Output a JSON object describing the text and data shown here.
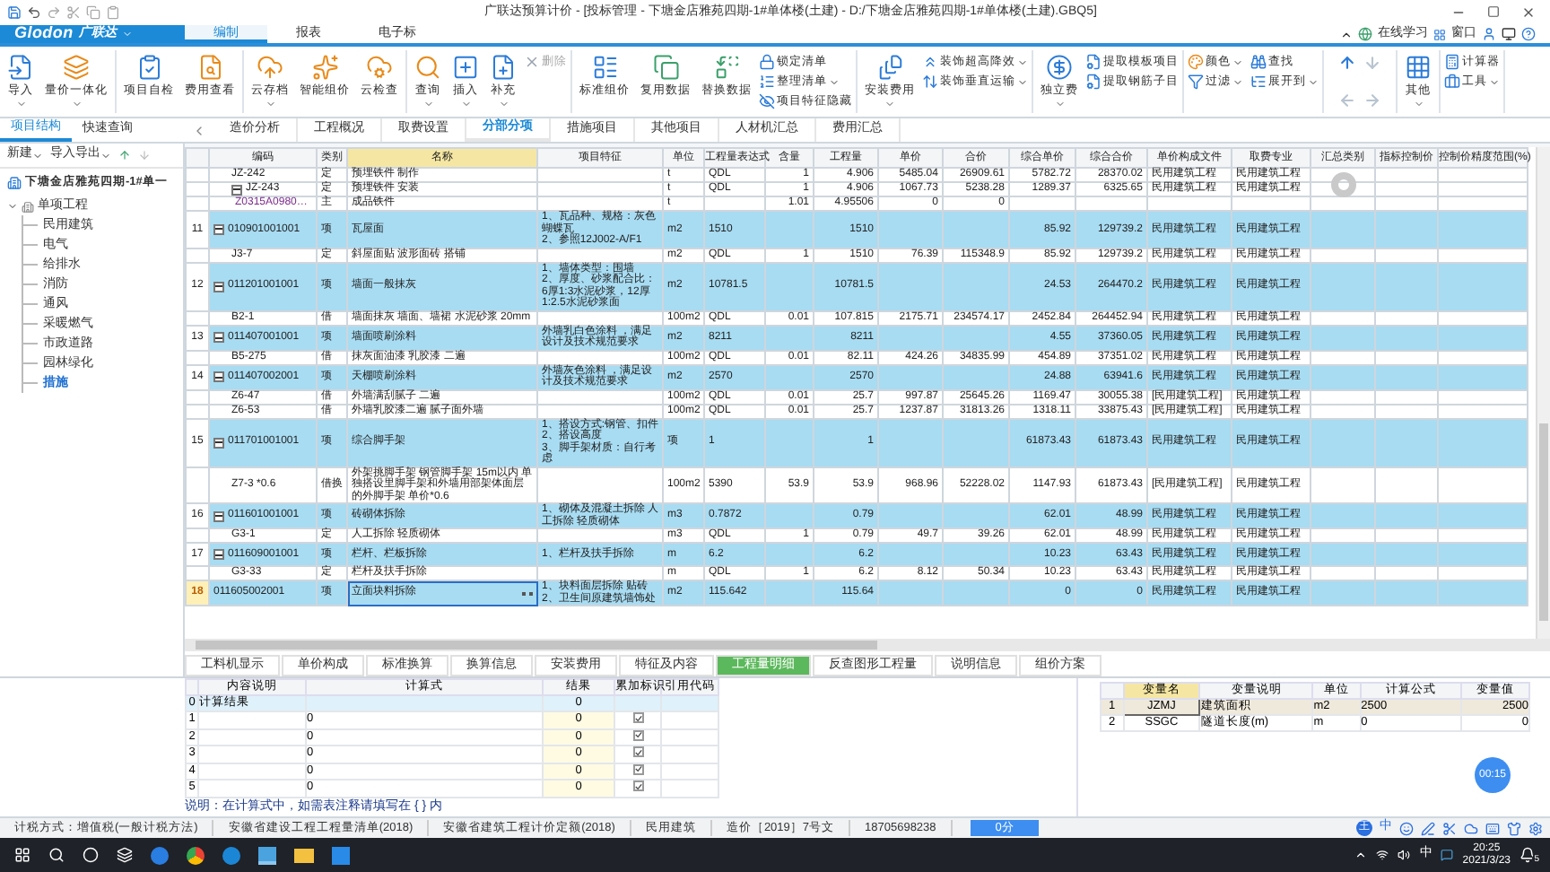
{
  "window": {
    "title": "广联达预算计价 - [投标管理 - 下塘金店雅苑四期-1#单体楼(土建) - D:/下塘金店雅苑四期-1#单体楼(土建).GBQ5]"
  },
  "app_menu": {
    "logo_latin": "Glodon",
    "logo_cn": "广联达",
    "tabs": [
      {
        "label": "编制",
        "selected": true
      },
      {
        "label": "报表",
        "selected": false
      },
      {
        "label": "电子标",
        "selected": false
      }
    ],
    "learn": "在线学习",
    "window_menu": "窗口"
  },
  "ribbon": [
    {
      "kind": "buttons",
      "items": [
        {
          "label": "导入",
          "kind": "large",
          "dropdown": true
        },
        {
          "label": "量价一体化",
          "kind": "large",
          "dropdown": true
        }
      ]
    },
    {
      "kind": "buttons",
      "items": [
        {
          "label": "项目自检",
          "kind": "large",
          "dropdown": false
        },
        {
          "label": "费用查看",
          "kind": "large",
          "dropdown": false
        }
      ]
    },
    {
      "kind": "buttons",
      "items": [
        {
          "label": "云存档",
          "kind": "large",
          "dropdown": true
        },
        {
          "label": "智能组价",
          "kind": "large",
          "dropdown": false
        },
        {
          "label": "云检查",
          "kind": "large",
          "dropdown": false
        }
      ]
    },
    {
      "kind": "buttons",
      "items": [
        {
          "label": "查询",
          "kind": "large",
          "dropdown": true
        },
        {
          "label": "插入",
          "kind": "large",
          "dropdown": true
        },
        {
          "label": "补充",
          "kind": "large",
          "dropdown": true
        },
        {
          "label": "删除",
          "kind": "small",
          "dropdown": false,
          "disabled": true
        }
      ]
    },
    {
      "kind": "buttons",
      "items": [
        {
          "label": "标准组价",
          "kind": "large",
          "dropdown": false
        },
        {
          "label": "复用数据",
          "kind": "large",
          "dropdown": false
        },
        {
          "label": "替换数据",
          "kind": "large",
          "dropdown": false
        },
        {
          "label": "锁定清单",
          "kind": "small",
          "dropdown": false
        },
        {
          "label": "整理清单",
          "kind": "small",
          "dropdown": true
        },
        {
          "label": "项目特征隐藏",
          "kind": "small",
          "dropdown": false
        }
      ]
    },
    {
      "kind": "buttons",
      "items": [
        {
          "label": "安装费用",
          "kind": "large",
          "dropdown": true
        },
        {
          "label": "装饰超高降效",
          "kind": "small",
          "dropdown": true
        },
        {
          "label": "装饰垂直运输",
          "kind": "small",
          "dropdown": true
        }
      ]
    },
    {
      "kind": "buttons",
      "items": [
        {
          "label": "独立费",
          "kind": "large",
          "dropdown": true
        },
        {
          "label": "提取模板项目",
          "kind": "small",
          "dropdown": false
        },
        {
          "label": "提取钢筋子目",
          "kind": "small",
          "dropdown": false
        }
      ]
    },
    {
      "kind": "buttons",
      "items": [
        {
          "label": "颜色",
          "kind": "small",
          "dropdown": true
        },
        {
          "label": "过滤",
          "kind": "small",
          "dropdown": true
        },
        {
          "label": "查找",
          "kind": "small",
          "dropdown": false
        },
        {
          "label": "展开到",
          "kind": "small",
          "dropdown": true
        }
      ]
    },
    {
      "kind": "arrows",
      "arrows": [
        {
          "kind": "up",
          "disabled": false
        },
        {
          "kind": "down",
          "disabled": true
        },
        {
          "kind": "left",
          "disabled": true
        },
        {
          "kind": "right",
          "disabled": true
        }
      ]
    },
    {
      "kind": "buttons",
      "items": [
        {
          "label": "其他",
          "kind": "large",
          "dropdown": true
        }
      ]
    },
    {
      "kind": "buttons",
      "items": [
        {
          "label": "计算器",
          "kind": "small",
          "dropdown": false
        },
        {
          "label": "工具",
          "kind": "small",
          "dropdown": true
        }
      ]
    }
  ],
  "left_tabs": [
    {
      "label": "项目结构",
      "selected": true
    },
    {
      "label": "快速查询",
      "selected": false
    }
  ],
  "main_tabs": [
    {
      "label": "造价分析",
      "selected": false
    },
    {
      "label": "工程概况",
      "selected": false
    },
    {
      "label": "取费设置",
      "selected": false
    },
    {
      "label": "分部分项",
      "selected": true
    },
    {
      "label": "措施项目",
      "selected": false
    },
    {
      "label": "其他项目",
      "selected": false
    },
    {
      "label": "人材机汇总",
      "selected": false
    },
    {
      "label": "费用汇总",
      "selected": false
    }
  ],
  "tree": {
    "toolbar": [
      "新建",
      "导入导出"
    ],
    "root": "下塘金店雅苑四期-1#单一",
    "children": [
      {
        "label": "单项工程",
        "expanded": true,
        "children": [
          {
            "label": "民用建筑",
            "selected": false
          },
          {
            "label": "电气",
            "selected": false
          },
          {
            "label": "给排水",
            "selected": false
          },
          {
            "label": "消防",
            "selected": false
          },
          {
            "label": "通风",
            "selected": false
          },
          {
            "label": "采暖燃气",
            "selected": false
          },
          {
            "label": "市政道路",
            "selected": false
          },
          {
            "label": "园林绿化",
            "selected": false
          },
          {
            "label": "措施",
            "selected": true
          }
        ]
      }
    ]
  },
  "table": {
    "columns": [
      {
        "label": "编码",
        "selected": false
      },
      {
        "label": "类别",
        "selected": false
      },
      {
        "label": "名称",
        "selected": true
      },
      {
        "label": "项目特征",
        "selected": false
      },
      {
        "label": "单位",
        "selected": false
      },
      {
        "label": "工程量表达式",
        "selected": false
      },
      {
        "label": "含量",
        "selected": false
      },
      {
        "label": "工程量",
        "selected": false
      },
      {
        "label": "单价",
        "selected": false
      },
      {
        "label": "合价",
        "selected": false
      },
      {
        "label": "综合单价",
        "selected": false
      },
      {
        "label": "综合合价",
        "selected": false
      },
      {
        "label": "单价构成文件",
        "selected": false
      },
      {
        "label": "取费专业",
        "selected": false
      },
      {
        "label": "汇总类别",
        "selected": false
      },
      {
        "label": "指标控制价",
        "selected": false
      },
      {
        "label": "控制价精度范围(%)",
        "selected": false
      }
    ],
    "rows": [
      {
        "kind": "quota",
        "no": "",
        "code": "JZ-242",
        "type": "定",
        "name": "预埋铁件 制作",
        "feature": "",
        "unit": "t",
        "expr": "QDL",
        "content": "1",
        "qty": "4.906",
        "price": "5485.04",
        "total": "26909.61",
        "unit_price": "5782.72",
        "unit_total": "28370.02",
        "price_file": "民用建筑工程",
        "fee_major": "民用建筑工程",
        "selected": false
      },
      {
        "kind": "quota",
        "no": "",
        "code": "JZ-243",
        "type": "定",
        "name": "预埋铁件 安装",
        "feature": "",
        "unit": "t",
        "expr": "QDL",
        "content": "1",
        "qty": "4.906",
        "price": "1067.73",
        "total": "5238.28",
        "unit_price": "1289.37",
        "unit_total": "6325.65",
        "price_file": "民用建筑工程",
        "fee_major": "民用建筑工程",
        "expanded": true,
        "selected": false
      },
      {
        "kind": "material",
        "no": "",
        "code": "Z0315A0980…",
        "type": "主",
        "name": "成品铁件",
        "feature": "",
        "unit": "t",
        "expr": "",
        "content": "1.01",
        "qty": "4.95506",
        "price": "0",
        "total": "0",
        "unit_price": "",
        "unit_total": "",
        "price_file": "",
        "fee_major": "",
        "selected": false
      },
      {
        "kind": "item",
        "no": "11",
        "code": "010901001001",
        "type": "项",
        "name": "瓦屋面",
        "feature": "1、瓦品种、规格：灰色蝴蝶瓦\n2、参照12J002-A/F1",
        "unit": "m2",
        "expr": "1510",
        "content": "",
        "qty": "1510",
        "price": "",
        "total": "",
        "unit_price": "85.92",
        "unit_total": "129739.2",
        "price_file": "民用建筑工程",
        "fee_major": "民用建筑工程",
        "expanded": true,
        "selected": false
      },
      {
        "kind": "quota",
        "no": "",
        "code": "J3-7",
        "type": "定",
        "name": "斜屋面贴 波形面砖 搭铺",
        "feature": "",
        "unit": "m2",
        "expr": "QDL",
        "content": "1",
        "qty": "1510",
        "price": "76.39",
        "total": "115348.9",
        "unit_price": "85.92",
        "unit_total": "129739.2",
        "price_file": "民用建筑工程",
        "fee_major": "民用建筑工程",
        "selected": false
      },
      {
        "kind": "item",
        "no": "12",
        "code": "011201001001",
        "type": "项",
        "name": "墙面一般抹灰",
        "feature": "1、墙体类型：围墙\n2、厚度、砂浆配合比：6厚1:3水泥砂浆，12厚1:2.5水泥砂浆面",
        "unit": "m2",
        "expr": "10781.5",
        "content": "",
        "qty": "10781.5",
        "price": "",
        "total": "",
        "unit_price": "24.53",
        "unit_total": "264470.2",
        "price_file": "民用建筑工程",
        "fee_major": "民用建筑工程",
        "expanded": true,
        "selected": false
      },
      {
        "kind": "quota",
        "no": "",
        "code": "B2-1",
        "type": "借",
        "name": "墙面抹灰 墙面、墙裙 水泥砂浆 20mm",
        "feature": "",
        "unit": "100m2",
        "expr": "QDL",
        "content": "0.01",
        "qty": "107.815",
        "price": "2175.71",
        "total": "234574.17",
        "unit_price": "2452.84",
        "unit_total": "264452.94",
        "price_file": "民用建筑工程",
        "fee_major": "民用建筑工程",
        "selected": false
      },
      {
        "kind": "item",
        "no": "13",
        "code": "011407001001",
        "type": "项",
        "name": "墙面喷刷涂料",
        "feature": "外墙乳白色涂料 ，满足设计及技术规范要求",
        "unit": "m2",
        "expr": "8211",
        "content": "",
        "qty": "8211",
        "price": "",
        "total": "",
        "unit_price": "4.55",
        "unit_total": "37360.05",
        "price_file": "民用建筑工程",
        "fee_major": "民用建筑工程",
        "expanded": true,
        "selected": false
      },
      {
        "kind": "quota",
        "no": "",
        "code": "B5-275",
        "type": "借",
        "name": "抹灰面油漆 乳胶漆 二遍",
        "feature": "",
        "unit": "100m2",
        "expr": "QDL",
        "content": "0.01",
        "qty": "82.11",
        "price": "424.26",
        "total": "34835.99",
        "unit_price": "454.89",
        "unit_total": "37351.02",
        "price_file": "民用建筑工程",
        "fee_major": "民用建筑工程",
        "selected": false
      },
      {
        "kind": "item",
        "no": "14",
        "code": "011407002001",
        "type": "项",
        "name": "天棚喷刷涂料",
        "feature": "外墙灰色涂料 ，满足设计及技术规范要求",
        "unit": "m2",
        "expr": "2570",
        "content": "",
        "qty": "2570",
        "price": "",
        "total": "",
        "unit_price": "24.88",
        "unit_total": "63941.6",
        "price_file": "民用建筑工程",
        "fee_major": "民用建筑工程",
        "expanded": true,
        "selected": false
      },
      {
        "kind": "quota",
        "no": "",
        "code": "Z6-47",
        "type": "借",
        "name": "外墙满刮腻子 二遍",
        "feature": "",
        "unit": "100m2",
        "expr": "QDL",
        "content": "0.01",
        "qty": "25.7",
        "price": "997.87",
        "total": "25645.26",
        "unit_price": "1169.47",
        "unit_total": "30055.38",
        "price_file": "[民用建筑工程]",
        "fee_major": "民用建筑工程",
        "selected": false
      },
      {
        "kind": "quota",
        "no": "",
        "code": "Z6-53",
        "type": "借",
        "name": "外墙乳胶漆二遍 腻子面外墙",
        "feature": "",
        "unit": "100m2",
        "expr": "QDL",
        "content": "0.01",
        "qty": "25.7",
        "price": "1237.87",
        "total": "31813.26",
        "unit_price": "1318.11",
        "unit_total": "33875.43",
        "price_file": "[民用建筑工程]",
        "fee_major": "民用建筑工程",
        "selected": false
      },
      {
        "kind": "item",
        "no": "15",
        "code": "011701001001",
        "type": "项",
        "name": "综合脚手架",
        "feature": "1、搭设方式:钢管、扣件\n2、搭设高度\n3、脚手架材质：自行考虑",
        "unit": "项",
        "expr": "1",
        "content": "",
        "qty": "1",
        "price": "",
        "total": "",
        "unit_price": "61873.43",
        "unit_total": "61873.43",
        "price_file": "民用建筑工程",
        "fee_major": "民用建筑工程",
        "expanded": true,
        "selected": false
      },
      {
        "kind": "quota",
        "no": "",
        "code": "Z7-3 *0.6",
        "type": "借换",
        "name": "外架挑脚手架 钢管脚手架 15m以内 单独搭设里脚手架和外墙用部架体面层的外脚手架 单价*0.6",
        "feature": "",
        "unit": "100m2",
        "expr": "5390",
        "content": "53.9",
        "qty": "53.9",
        "price": "968.96",
        "total": "52228.02",
        "unit_price": "1147.93",
        "unit_total": "61873.43",
        "price_file": "[民用建筑工程]",
        "fee_major": "民用建筑工程",
        "selected": false
      },
      {
        "kind": "item",
        "no": "16",
        "code": "011601001001",
        "type": "项",
        "name": "砖砌体拆除",
        "feature": "1、砌体及混凝土拆除 人工拆除 轻质砌体",
        "unit": "m3",
        "expr": "0.7872",
        "content": "",
        "qty": "0.79",
        "price": "",
        "total": "",
        "unit_price": "62.01",
        "unit_total": "48.99",
        "price_file": "民用建筑工程",
        "fee_major": "民用建筑工程",
        "expanded": true,
        "selected": false
      },
      {
        "kind": "quota",
        "no": "",
        "code": "G3-1",
        "type": "定",
        "name": "人工拆除 轻质砌体",
        "feature": "",
        "unit": "m3",
        "expr": "QDL",
        "content": "1",
        "qty": "0.79",
        "price": "49.7",
        "total": "39.26",
        "unit_price": "62.01",
        "unit_total": "48.99",
        "price_file": "民用建筑工程",
        "fee_major": "民用建筑工程",
        "selected": false
      },
      {
        "kind": "item",
        "no": "17",
        "code": "011609001001",
        "type": "项",
        "name": "栏杆、栏板拆除",
        "feature": "1、栏杆及扶手拆除",
        "unit": "m",
        "expr": "6.2",
        "content": "",
        "qty": "6.2",
        "price": "",
        "total": "",
        "unit_price": "10.23",
        "unit_total": "63.43",
        "price_file": "民用建筑工程",
        "fee_major": "民用建筑工程",
        "expanded": true,
        "selected": false
      },
      {
        "kind": "quota",
        "no": "",
        "code": "G3-33",
        "type": "定",
        "name": "栏杆及扶手拆除",
        "feature": "",
        "unit": "m",
        "expr": "QDL",
        "content": "1",
        "qty": "6.2",
        "price": "8.12",
        "total": "50.34",
        "unit_price": "10.23",
        "unit_total": "63.43",
        "price_file": "民用建筑工程",
        "fee_major": "民用建筑工程",
        "selected": false
      },
      {
        "kind": "item",
        "no": "18",
        "code": "011605002001",
        "type": "项",
        "name": "立面块料拆除",
        "feature": "1、块料面层拆除 贴砖\n2、卫生间原建筑墙饰处",
        "unit": "m2",
        "expr": "115.642",
        "content": "",
        "qty": "115.64",
        "price": "",
        "total": "",
        "unit_price": "0",
        "unit_total": "0",
        "price_file": "民用建筑工程",
        "fee_major": "民用建筑工程",
        "selected": true
      }
    ]
  },
  "detail_tabs": [
    {
      "label": "工料机显示",
      "selected": false
    },
    {
      "label": "单价构成",
      "selected": false
    },
    {
      "label": "标准换算",
      "selected": false
    },
    {
      "label": "换算信息",
      "selected": false
    },
    {
      "label": "安装费用",
      "selected": false
    },
    {
      "label": "特征及内容",
      "selected": false
    },
    {
      "label": "工程量明细",
      "selected": true
    },
    {
      "label": "反查图形工程量",
      "selected": false
    },
    {
      "label": "说明信息",
      "selected": false
    },
    {
      "label": "组价方案",
      "selected": false
    }
  ],
  "detail_grid": {
    "columns": [
      "内容说明",
      "计算式",
      "结果",
      "累加标识",
      "引用代码"
    ],
    "rows": [
      {
        "kind": "total",
        "no": "0",
        "desc": "计算结果",
        "formula": "",
        "result": "0"
      },
      {
        "kind": "line",
        "no": "1",
        "desc": "",
        "formula": "0",
        "result": "0",
        "accumulate": true
      },
      {
        "kind": "line",
        "no": "2",
        "desc": "",
        "formula": "0",
        "result": "0",
        "accumulate": true
      },
      {
        "kind": "line",
        "no": "3",
        "desc": "",
        "formula": "0",
        "result": "0",
        "accumulate": true
      },
      {
        "kind": "line",
        "no": "4",
        "desc": "",
        "formula": "0",
        "result": "0",
        "accumulate": true
      },
      {
        "kind": "line",
        "no": "5",
        "desc": "",
        "formula": "0",
        "result": "0",
        "accumulate": true
      }
    ]
  },
  "note": "说明：在计算式中，如需表注释请填写在 { } 内",
  "variables": {
    "columns": [
      "变量名",
      "变量说明",
      "单位",
      "计算公式",
      "变量值"
    ],
    "rows": [
      {
        "no": "1",
        "name": "JZMJ",
        "desc": "建筑面积",
        "unit": "m2",
        "formula": "2500",
        "value": "2500",
        "selected": true
      },
      {
        "no": "2",
        "name": "SSGC",
        "desc": "隧道长度(m)",
        "unit": "m",
        "formula": "0",
        "value": "0",
        "selected": false
      }
    ]
  },
  "timer": "00:15",
  "status_bar": [
    "计税方式：增值税(一般计税方法)",
    "安徽省建设工程工程量清单(2018)",
    "安徽省建筑工程计价定额(2018)",
    "民用建筑",
    "造价［2019］7号文",
    "18705698238"
  ],
  "status_button": "0分",
  "ime_toolbar": {
    "badge": "王",
    "mode": "中"
  },
  "taskbar": {
    "ime": "中",
    "time": "20:25",
    "date": "2021/3/23",
    "notifications": "5"
  }
}
